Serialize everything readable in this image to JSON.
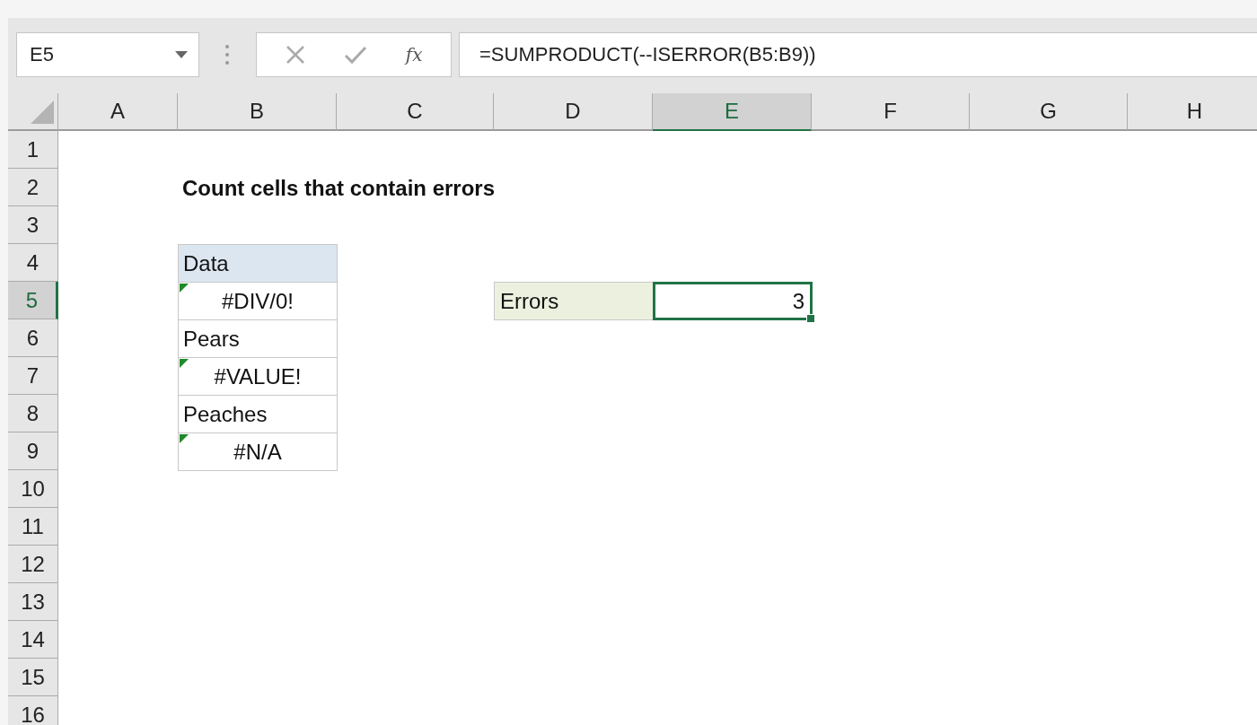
{
  "name_box": {
    "value": "E5"
  },
  "formula_bar": {
    "function_label": "fx",
    "formula": "=SUMPRODUCT(--ISERROR(B5:B9))"
  },
  "columns": [
    {
      "label": "A",
      "selected": false
    },
    {
      "label": "B",
      "selected": false
    },
    {
      "label": "C",
      "selected": false
    },
    {
      "label": "D",
      "selected": false
    },
    {
      "label": "E",
      "selected": true
    },
    {
      "label": "F",
      "selected": false
    },
    {
      "label": "G",
      "selected": false
    },
    {
      "label": "H",
      "selected": false
    }
  ],
  "rows": [
    {
      "label": "1",
      "selected": false
    },
    {
      "label": "2",
      "selected": false,
      "cells": {
        "B": {
          "kind": "title",
          "text": "Count cells that contain errors"
        }
      }
    },
    {
      "label": "3",
      "selected": false
    },
    {
      "label": "4",
      "selected": false,
      "cells": {
        "B": {
          "kind": "header",
          "text": "Data"
        }
      }
    },
    {
      "label": "5",
      "selected": true,
      "cells": {
        "B": {
          "kind": "error",
          "text": "#DIV/0!"
        },
        "D": {
          "kind": "label",
          "text": "Errors"
        },
        "E": {
          "kind": "number",
          "text": "3",
          "selected": true
        }
      }
    },
    {
      "label": "6",
      "selected": false,
      "cells": {
        "B": {
          "kind": "text",
          "text": "Pears"
        }
      }
    },
    {
      "label": "7",
      "selected": false,
      "cells": {
        "B": {
          "kind": "error",
          "text": "#VALUE!"
        }
      }
    },
    {
      "label": "8",
      "selected": false,
      "cells": {
        "B": {
          "kind": "text",
          "text": "Peaches"
        }
      }
    },
    {
      "label": "9",
      "selected": false,
      "cells": {
        "B": {
          "kind": "error",
          "text": "#N/A"
        }
      }
    },
    {
      "label": "10",
      "selected": false
    },
    {
      "label": "11",
      "selected": false
    },
    {
      "label": "12",
      "selected": false
    },
    {
      "label": "13",
      "selected": false
    },
    {
      "label": "14",
      "selected": false
    },
    {
      "label": "15",
      "selected": false
    },
    {
      "label": "16",
      "selected": false
    }
  ]
}
